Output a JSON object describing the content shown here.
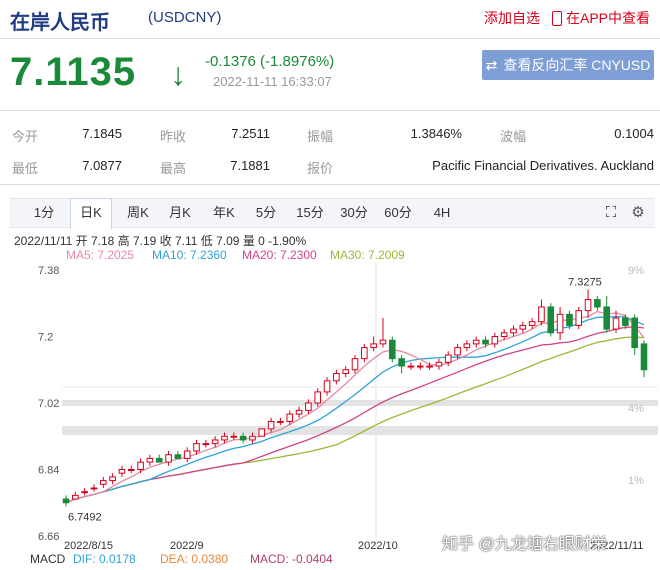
{
  "header": {
    "title": "在岸人民币",
    "code": "(USDCNY)",
    "add_watchlist": "添加自选",
    "view_in_app": "在APP中查看"
  },
  "quote": {
    "price": "7.1135",
    "change": "-0.1376 (-1.8976%)",
    "timestamp": "2022-11-11 16:33:07",
    "reverse_button": "查看反向汇率 CNYUSD",
    "down_color": "#1a8a3a",
    "up_color": "#d9001b"
  },
  "stats": {
    "open_label": "今开",
    "open_value": "7.1845",
    "prev_close_label": "昨收",
    "prev_close_value": "7.2511",
    "amplitude_label": "振幅",
    "amplitude_value": "1.3846%",
    "volatility_label": "波幅",
    "volatility_value": "0.1004",
    "low_label": "最低",
    "low_value": "7.0877",
    "high_label": "最高",
    "high_value": "7.1881",
    "source_label": "报价",
    "source_value": "Pacific Financial Derivatives. Auckland"
  },
  "tabs": [
    "1分",
    "日K",
    "周K",
    "月K",
    "年K",
    "5分",
    "15分",
    "30分",
    "60分",
    "4H"
  ],
  "active_tab": "日K",
  "ohlc_line": "2022/11/11 开 7.18 高 7.19 收 7.11 低 7.09 量 0 -1.90%",
  "ma": {
    "ma5": "MA5: 7.2025",
    "ma10": "MA10: 7.2360",
    "ma20": "MA20: 7.2300",
    "ma30": "MA30: 7.2009",
    "ma5_color": "#e68aa0",
    "ma10_color": "#2fa3d6",
    "ma20_color": "#d2448a",
    "ma30_color": "#a3b43a"
  },
  "chart_data": {
    "type": "candlestick",
    "y_ticks": [
      "7.38",
      "7.2",
      "7.02",
      "6.84",
      "6.66"
    ],
    "right_ticks": [
      "9%",
      "4%",
      "1%"
    ],
    "x_labels": [
      "2022/8/15",
      "2022/9",
      "2022/10",
      "2022/11/11"
    ],
    "max_label": "7.3275",
    "min_label": "6.7492",
    "ylim": [
      6.66,
      7.38
    ],
    "candles": [
      {
        "o": 6.76,
        "h": 6.77,
        "l": 6.74,
        "c": 6.75
      },
      {
        "o": 6.76,
        "h": 6.78,
        "l": 6.76,
        "c": 6.77
      },
      {
        "o": 6.78,
        "h": 6.79,
        "l": 6.77,
        "c": 6.78
      },
      {
        "o": 6.79,
        "h": 6.8,
        "l": 6.78,
        "c": 6.79
      },
      {
        "o": 6.8,
        "h": 6.82,
        "l": 6.79,
        "c": 6.81
      },
      {
        "o": 6.81,
        "h": 6.83,
        "l": 6.8,
        "c": 6.82
      },
      {
        "o": 6.83,
        "h": 6.85,
        "l": 6.82,
        "c": 6.84
      },
      {
        "o": 6.84,
        "h": 6.85,
        "l": 6.83,
        "c": 6.84
      },
      {
        "o": 6.84,
        "h": 6.87,
        "l": 6.83,
        "c": 6.86
      },
      {
        "o": 6.86,
        "h": 6.88,
        "l": 6.85,
        "c": 6.87
      },
      {
        "o": 6.87,
        "h": 6.88,
        "l": 6.86,
        "c": 6.86
      },
      {
        "o": 6.86,
        "h": 6.89,
        "l": 6.85,
        "c": 6.88
      },
      {
        "o": 6.88,
        "h": 6.89,
        "l": 6.87,
        "c": 6.87
      },
      {
        "o": 6.87,
        "h": 6.9,
        "l": 6.86,
        "c": 6.89
      },
      {
        "o": 6.89,
        "h": 6.92,
        "l": 6.88,
        "c": 6.91
      },
      {
        "o": 6.91,
        "h": 6.92,
        "l": 6.9,
        "c": 6.91
      },
      {
        "o": 6.91,
        "h": 6.93,
        "l": 6.9,
        "c": 6.92
      },
      {
        "o": 6.92,
        "h": 6.94,
        "l": 6.91,
        "c": 6.93
      },
      {
        "o": 6.93,
        "h": 6.94,
        "l": 6.92,
        "c": 6.93
      },
      {
        "o": 6.93,
        "h": 6.94,
        "l": 6.91,
        "c": 6.92
      },
      {
        "o": 6.92,
        "h": 6.94,
        "l": 6.91,
        "c": 6.93
      },
      {
        "o": 6.93,
        "h": 6.95,
        "l": 6.93,
        "c": 6.95
      },
      {
        "o": 6.95,
        "h": 6.98,
        "l": 6.94,
        "c": 6.97
      },
      {
        "o": 6.97,
        "h": 6.98,
        "l": 6.96,
        "c": 6.97
      },
      {
        "o": 6.97,
        "h": 7.0,
        "l": 6.96,
        "c": 6.99
      },
      {
        "o": 6.99,
        "h": 7.01,
        "l": 6.98,
        "c": 7.0
      },
      {
        "o": 7.0,
        "h": 7.03,
        "l": 6.99,
        "c": 7.02
      },
      {
        "o": 7.02,
        "h": 7.06,
        "l": 7.01,
        "c": 7.05
      },
      {
        "o": 7.05,
        "h": 7.09,
        "l": 7.04,
        "c": 7.08
      },
      {
        "o": 7.08,
        "h": 7.11,
        "l": 7.07,
        "c": 7.1
      },
      {
        "o": 7.1,
        "h": 7.12,
        "l": 7.09,
        "c": 7.11
      },
      {
        "o": 7.11,
        "h": 7.15,
        "l": 7.1,
        "c": 7.14
      },
      {
        "o": 7.14,
        "h": 7.18,
        "l": 7.13,
        "c": 7.17
      },
      {
        "o": 7.17,
        "h": 7.2,
        "l": 7.16,
        "c": 7.18
      },
      {
        "o": 7.18,
        "h": 7.25,
        "l": 7.17,
        "c": 7.19
      },
      {
        "o": 7.19,
        "h": 7.2,
        "l": 7.13,
        "c": 7.14
      },
      {
        "o": 7.14,
        "h": 7.15,
        "l": 7.1,
        "c": 7.12
      },
      {
        "o": 7.12,
        "h": 7.13,
        "l": 7.11,
        "c": 7.12
      },
      {
        "o": 7.12,
        "h": 7.13,
        "l": 7.11,
        "c": 7.12
      },
      {
        "o": 7.12,
        "h": 7.13,
        "l": 7.11,
        "c": 7.12
      },
      {
        "o": 7.12,
        "h": 7.14,
        "l": 7.11,
        "c": 7.13
      },
      {
        "o": 7.13,
        "h": 7.16,
        "l": 7.12,
        "c": 7.15
      },
      {
        "o": 7.15,
        "h": 7.18,
        "l": 7.14,
        "c": 7.17
      },
      {
        "o": 7.17,
        "h": 7.19,
        "l": 7.16,
        "c": 7.18
      },
      {
        "o": 7.18,
        "h": 7.2,
        "l": 7.17,
        "c": 7.19
      },
      {
        "o": 7.19,
        "h": 7.2,
        "l": 7.17,
        "c": 7.18
      },
      {
        "o": 7.18,
        "h": 7.21,
        "l": 7.17,
        "c": 7.2
      },
      {
        "o": 7.2,
        "h": 7.22,
        "l": 7.19,
        "c": 7.21
      },
      {
        "o": 7.21,
        "h": 7.23,
        "l": 7.2,
        "c": 7.22
      },
      {
        "o": 7.22,
        "h": 7.24,
        "l": 7.21,
        "c": 7.23
      },
      {
        "o": 7.23,
        "h": 7.25,
        "l": 7.22,
        "c": 7.24
      },
      {
        "o": 7.24,
        "h": 7.3,
        "l": 7.23,
        "c": 7.28
      },
      {
        "o": 7.28,
        "h": 7.29,
        "l": 7.2,
        "c": 7.21
      },
      {
        "o": 7.21,
        "h": 7.28,
        "l": 7.19,
        "c": 7.26
      },
      {
        "o": 7.26,
        "h": 7.27,
        "l": 7.22,
        "c": 7.23
      },
      {
        "o": 7.23,
        "h": 7.28,
        "l": 7.22,
        "c": 7.27
      },
      {
        "o": 7.27,
        "h": 7.3275,
        "l": 7.25,
        "c": 7.3
      },
      {
        "o": 7.3,
        "h": 7.31,
        "l": 7.27,
        "c": 7.28
      },
      {
        "o": 7.28,
        "h": 7.31,
        "l": 7.21,
        "c": 7.22
      },
      {
        "o": 7.22,
        "h": 7.27,
        "l": 7.21,
        "c": 7.25
      },
      {
        "o": 7.25,
        "h": 7.26,
        "l": 7.22,
        "c": 7.23
      },
      {
        "o": 7.25,
        "h": 7.26,
        "l": 7.15,
        "c": 7.17
      },
      {
        "o": 7.18,
        "h": 7.19,
        "l": 7.09,
        "c": 7.11
      }
    ]
  },
  "macd": {
    "label": "MACD",
    "dif": "DIF: 0.0178",
    "dea": "DEA: 0.0380",
    "macd": "MACD: -0.0404"
  },
  "watermark": "知乎 @九龙塘右眼财栄"
}
